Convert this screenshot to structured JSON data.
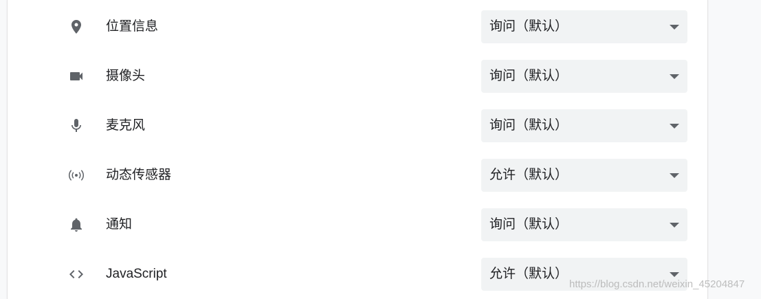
{
  "permissions": [
    {
      "label": "位置信息",
      "value": "询问（默认）",
      "icon": "location-pin-icon"
    },
    {
      "label": "摄像头",
      "value": "询问（默认）",
      "icon": "videocam-icon"
    },
    {
      "label": "麦克风",
      "value": "询问（默认）",
      "icon": "mic-icon"
    },
    {
      "label": "动态传感器",
      "value": "允许（默认）",
      "icon": "sensors-icon"
    },
    {
      "label": "通知",
      "value": "询问（默认）",
      "icon": "bell-icon"
    },
    {
      "label": "JavaScript",
      "value": "允许（默认）",
      "icon": "code-icon"
    }
  ],
  "watermark": "https://blog.csdn.net/weixin_45204847",
  "colors": {
    "icon": "#5f6368",
    "text": "#202124",
    "select_bg": "#f1f3f4",
    "page_bg": "#f8f9fa"
  }
}
